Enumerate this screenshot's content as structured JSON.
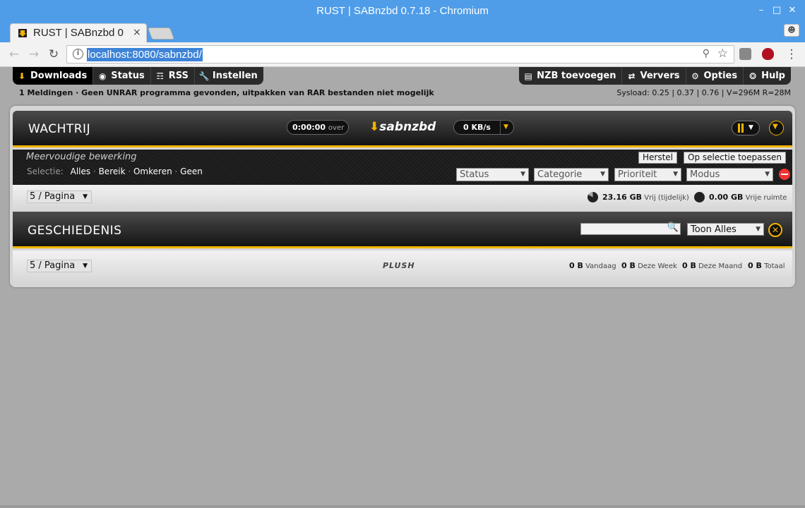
{
  "window": {
    "title": "RUST | SABnzbd 0.7.18 - Chromium",
    "minimize": "–",
    "maximize": "□",
    "close": "✕"
  },
  "tab": {
    "label": "RUST | SABnzbd 0",
    "close": "×"
  },
  "address": {
    "url": "localhost:8080/sabnzbd/"
  },
  "nav": {
    "left": [
      {
        "label": "Downloads",
        "icon": "download-icon"
      },
      {
        "label": "Status",
        "icon": "status-icon"
      },
      {
        "label": "RSS",
        "icon": "rss-icon"
      },
      {
        "label": "Instellen",
        "icon": "wrench-icon"
      }
    ],
    "right": [
      {
        "label": "NZB toevoegen",
        "icon": "nzb-add-icon"
      },
      {
        "label": "Ververs",
        "icon": "refresh-icon"
      },
      {
        "label": "Opties",
        "icon": "gear-icon"
      },
      {
        "label": "Hulp",
        "icon": "help-icon"
      }
    ]
  },
  "status_line": {
    "messages": "1 Meldingen · Geen UNRAR programma gevonden, uitpakken van RAR bestanden niet mogelijk",
    "sysload": "Sysload: 0.25 | 0.37 | 0.76 | V=296M R=28M"
  },
  "queue": {
    "title": "WACHTRIJ",
    "time_left": "0:00:00",
    "time_left_suffix": "over",
    "logo": "sabnzbd",
    "speed": "0 KB/s",
    "multi_edit": "Meervoudige bewerking",
    "selection_label": "Selectie:",
    "selection_links": [
      "Alles",
      "Bereik",
      "Omkeren",
      "Geen"
    ],
    "reset_button": "Herstel",
    "apply_button": "Op selectie toepassen",
    "filters": [
      "Status",
      "Categorie",
      "Prioriteit",
      "Modus"
    ],
    "per_page": "5 / Pagina",
    "free_temp_value": "23.16 GB",
    "free_temp_label": "Vrij (tijdelijk)",
    "free_space_value": "0.00 GB",
    "free_space_label": "Vrije ruimte"
  },
  "history": {
    "title": "GESCHIEDENIS",
    "search_placeholder": "",
    "show_filter": "Toon Alles",
    "per_page": "5 / Pagina",
    "brand": "PLUSH",
    "stats": [
      {
        "value": "0 B",
        "label": "Vandaag"
      },
      {
        "value": "0 B",
        "label": "Deze Week"
      },
      {
        "value": "0 B",
        "label": "Deze Maand"
      },
      {
        "value": "0 B",
        "label": "Totaal"
      }
    ]
  },
  "colors": {
    "accent": "#f2b400",
    "chrome_blue": "#4f9de8",
    "panel_dark": "#1a1a1a"
  }
}
